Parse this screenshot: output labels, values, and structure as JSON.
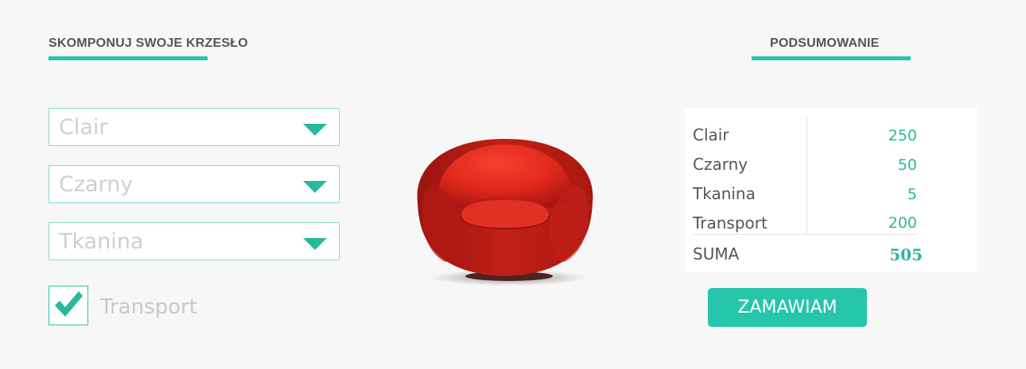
{
  "left_panel": {
    "title": "SKOMPONUJ SWOJE KRZESŁO",
    "selects": [
      {
        "value": "Clair"
      },
      {
        "value": "Czarny"
      },
      {
        "value": "Tkanina"
      }
    ],
    "checkbox": {
      "label": "Transport",
      "checked": true
    }
  },
  "summary": {
    "title": "PODSUMOWANIE",
    "rows": [
      {
        "name": "Clair",
        "value": "250"
      },
      {
        "name": "Czarny",
        "value": "50"
      },
      {
        "name": "Tkanina",
        "value": "5"
      },
      {
        "name": "Transport",
        "value": "200"
      }
    ],
    "total_label": "SUMA",
    "total_value": "505",
    "order_button": "ZAMAWIAM"
  },
  "colors": {
    "accent": "#26c6aa",
    "chair": "#e0281e"
  },
  "icons": {
    "select_arrow": "triangle-down-icon",
    "checkbox": "checkmark-icon"
  }
}
